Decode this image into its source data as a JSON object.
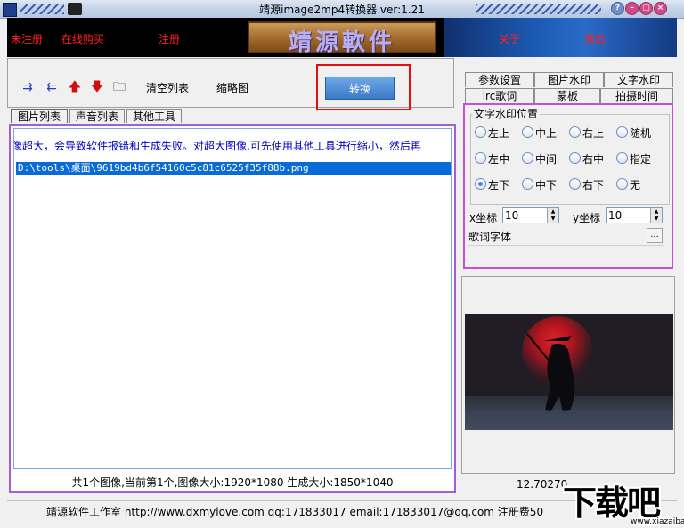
{
  "window": {
    "title": "靖源image2mp4转换器 ver:1.21",
    "buttons": [
      "help-button",
      "minimize-button",
      "maximize-button",
      "close-button"
    ]
  },
  "banner": {
    "links": [
      "未注册",
      "在线购买",
      "注册"
    ],
    "logo": "靖源軟件",
    "right_links": [
      "关于",
      "退出"
    ]
  },
  "toolbar": {
    "icons": [
      "add-files-icon",
      "remove-file-icon",
      "move-up-icon",
      "move-down-icon",
      "open-folder-icon"
    ],
    "clear_list_label": "清空列表",
    "thumbnail_label": "缩略图",
    "convert_label": "转换"
  },
  "left_tabs": [
    "图片列表",
    "声音列表",
    "其他工具"
  ],
  "list": {
    "warning": "像超大，会导致软件报错和生成失败。对超大图像,可先使用其他工具进行缩小，然后再",
    "files": [
      "D:\\tools\\桌面\\9619bd4b6f54160c5c81c6525f35f88b.png"
    ],
    "status": "共1个图像,当前第1个,图像大小:1920*1080 生成大小:1850*1040"
  },
  "right_tabs_row1": [
    "参数设置",
    "图片水印",
    "文字水印"
  ],
  "right_tabs_row2": [
    "lrc歌词",
    "蒙板",
    "拍摄时间"
  ],
  "text_watermark": {
    "group_label": "文字水印位置",
    "positions": [
      "左上",
      "中上",
      "右上",
      "随机",
      "左中",
      "中间",
      "右中",
      "指定",
      "左下",
      "中下",
      "右下",
      "无"
    ],
    "selected": "左下",
    "x_label": "x坐标",
    "x_value": "10",
    "y_label": "y坐标",
    "y_value": "10",
    "font_label": "歌词字体",
    "font_button": "..."
  },
  "preview": {
    "coord_readout": "12.70270"
  },
  "footer": {
    "text": "靖源软件工作室 http://www.dxmylove.com qq:171833017 email:171833017@qq.com 注册费50"
  },
  "watermark": {
    "text": "下载吧",
    "url": "www.xiazaiba.com"
  },
  "colors": {
    "highlight_red": "#e01010",
    "panel_purple": "#a45cd8",
    "selection_blue": "#0a6ad8",
    "convert_button": "#3a79c9"
  }
}
